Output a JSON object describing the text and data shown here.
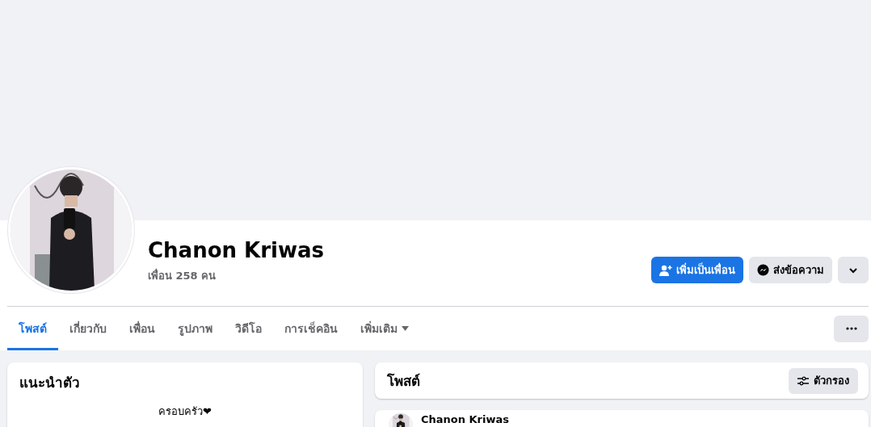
{
  "profile": {
    "name": "Chanon Kriwas",
    "friends": "เพื่อน 258 คน"
  },
  "actions": [
    {
      "kind": "primary",
      "label": "เพิ่มเป็นเพื่อน"
    },
    {
      "kind": "secondary",
      "label": "ส่งข้อความ"
    },
    {
      "kind": "more"
    }
  ],
  "tabs": [
    {
      "label": "โพสต์",
      "selected": true,
      "dropdown": false
    },
    {
      "label": "เกี่ยวกับ",
      "selected": false,
      "dropdown": false
    },
    {
      "label": "เพื่อน",
      "selected": false,
      "dropdown": false
    },
    {
      "label": "รูปภาพ",
      "selected": false,
      "dropdown": false
    },
    {
      "label": "วิดีโอ",
      "selected": false,
      "dropdown": false
    },
    {
      "label": "การเช็คอิน",
      "selected": false,
      "dropdown": false
    },
    {
      "label": "เพิ่มเติม",
      "selected": false,
      "dropdown": true
    }
  ],
  "intro": {
    "title": "แนะนำตัว",
    "bio": "ครอบครัว❤"
  },
  "posts": {
    "title": "โพสต์",
    "filter_button": "ตัวกรอง",
    "first_post_author": "Chanon Kriwas"
  }
}
